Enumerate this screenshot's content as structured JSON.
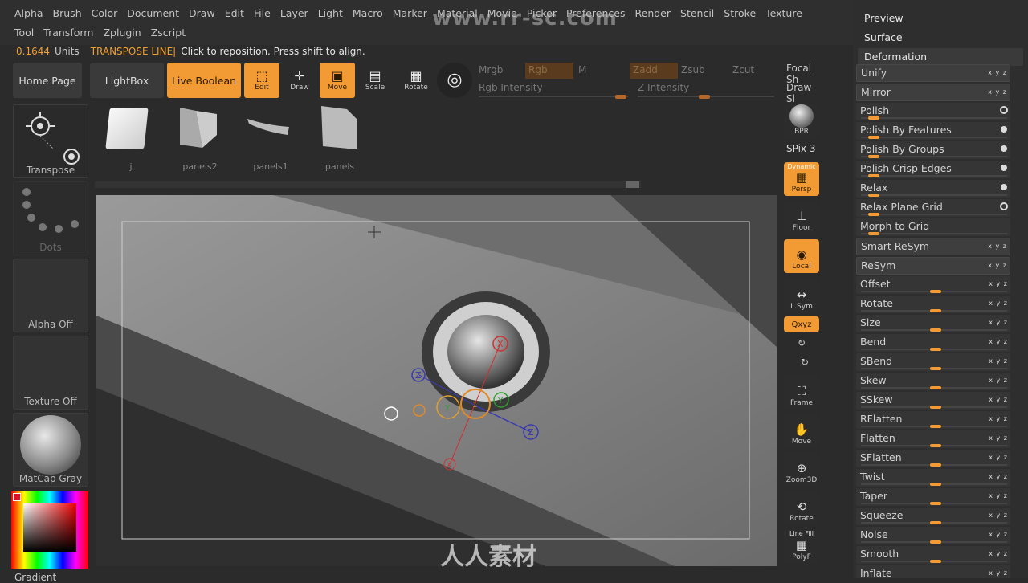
{
  "menu": {
    "row1": [
      "Alpha",
      "Brush",
      "Color",
      "Document",
      "Draw",
      "Edit",
      "File",
      "Layer",
      "Light",
      "Macro",
      "Marker",
      "Material",
      "Movie",
      "Picker",
      "Preferences",
      "Render",
      "Stencil",
      "Stroke",
      "Texture"
    ],
    "row2": [
      "Tool",
      "Transform",
      "Zplugin",
      "Zscript"
    ]
  },
  "watermark_top": "www.rr-sc.com",
  "watermark_bottom": "人人素材",
  "status": {
    "value": "0.1644",
    "units": "Units",
    "mode": "TRANSPOSE LINE",
    "message": "Click to reposition. Press shift to align."
  },
  "toolbar": {
    "home_page": "Home Page",
    "lightbox": "LightBox",
    "live_boolean": "Live Boolean",
    "edit": "Edit",
    "draw": "Draw",
    "move": "Move",
    "scale": "Scale",
    "rotate": "Rotate",
    "mrgb": "Mrgb",
    "rgb": "Rgb",
    "m": "M",
    "zadd": "Zadd",
    "zsub": "Zsub",
    "zcut": "Zcut",
    "rgb_intensity": "Rgb Intensity",
    "z_intensity": "Z Intensity",
    "focal": "Focal Sh",
    "draw_size": "Draw Si"
  },
  "left": {
    "transpose": "Transpose",
    "dots": "Dots",
    "alpha": "Alpha Off",
    "texture": "Texture Off",
    "matcap": "MatCap Gray",
    "gradient": "Gradient"
  },
  "thumbs": [
    "j",
    "panels2",
    "panels1",
    "panels"
  ],
  "right_strip": {
    "bpr": "BPR",
    "spix": "SPix 3",
    "dynamic": "Dynamic",
    "persp": "Persp",
    "floor": "Floor",
    "local": "Local",
    "lsym": "L.Sym",
    "xyz": "Qxyz",
    "frame": "Frame",
    "move": "Move",
    "zoom3d": "Zoom3D",
    "rotate": "Rotate",
    "linefill": "Line Fill",
    "polyf": "PolyF"
  },
  "panel": {
    "headers": [
      "Preview",
      "Surface",
      "Deformation"
    ],
    "items": [
      {
        "label": "Unify",
        "kind": "btn",
        "mark": "xyz"
      },
      {
        "label": "Mirror",
        "kind": "btn",
        "mark": "xyz"
      },
      {
        "label": "Polish",
        "kind": "slider",
        "mark": "ring",
        "level": 0.05
      },
      {
        "label": "Polish By Features",
        "kind": "slider",
        "mark": "dot",
        "level": 0.05
      },
      {
        "label": "Polish By Groups",
        "kind": "slider",
        "mark": "dot",
        "level": 0.05
      },
      {
        "label": "Polish Crisp Edges",
        "kind": "slider",
        "mark": "dot",
        "level": 0.05
      },
      {
        "label": "Relax",
        "kind": "slider",
        "mark": "dot",
        "level": 0.05
      },
      {
        "label": "Relax Plane Grid",
        "kind": "slider",
        "mark": "ring",
        "level": 0.05
      },
      {
        "label": "Morph to Grid",
        "kind": "slider",
        "mark": "none",
        "level": 0.05
      },
      {
        "label": "Smart ReSym",
        "kind": "btn",
        "mark": "xyz"
      },
      {
        "label": "ReSym",
        "kind": "btn",
        "mark": "xyz"
      },
      {
        "label": "Offset",
        "kind": "slider",
        "mark": "xyz",
        "level": 0.5
      },
      {
        "label": "Rotate",
        "kind": "slider",
        "mark": "xyz",
        "level": 0.5
      },
      {
        "label": "Size",
        "kind": "slider",
        "mark": "xyz",
        "level": 0.5
      },
      {
        "label": "Bend",
        "kind": "slider",
        "mark": "xyz",
        "level": 0.5
      },
      {
        "label": "SBend",
        "kind": "slider",
        "mark": "xyz",
        "level": 0.5
      },
      {
        "label": "Skew",
        "kind": "slider",
        "mark": "xyz",
        "level": 0.5
      },
      {
        "label": "SSkew",
        "kind": "slider",
        "mark": "xyz",
        "level": 0.5
      },
      {
        "label": "RFlatten",
        "kind": "slider",
        "mark": "xyz",
        "level": 0.5
      },
      {
        "label": "Flatten",
        "kind": "slider",
        "mark": "xyz",
        "level": 0.5
      },
      {
        "label": "SFlatten",
        "kind": "slider",
        "mark": "xyz",
        "level": 0.5
      },
      {
        "label": "Twist",
        "kind": "slider",
        "mark": "xyz",
        "level": 0.5
      },
      {
        "label": "Taper",
        "kind": "slider",
        "mark": "xyz",
        "level": 0.5
      },
      {
        "label": "Squeeze",
        "kind": "slider",
        "mark": "xyz",
        "level": 0.5
      },
      {
        "label": "Noise",
        "kind": "slider",
        "mark": "xyz",
        "level": 0.5
      },
      {
        "label": "Smooth",
        "kind": "slider",
        "mark": "xyz",
        "level": 0.5
      },
      {
        "label": "Inflate",
        "kind": "slider",
        "mark": "xyz",
        "level": 0.5
      }
    ]
  },
  "gizmo": {
    "x": "X",
    "y": "Y",
    "z": "Z",
    "one": "1"
  },
  "colors": {
    "accent": "#f29a33",
    "panel_bg": "#2e2e2e",
    "viewport_bg": "#5a5a5a"
  }
}
